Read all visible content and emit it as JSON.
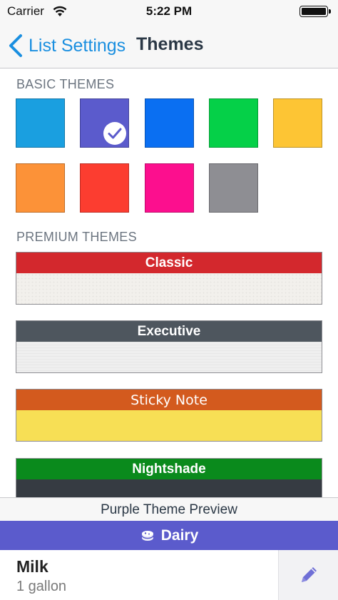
{
  "status_bar": {
    "carrier": "Carrier",
    "time": "5:22 PM"
  },
  "nav": {
    "back_label": "List Settings",
    "title": "Themes"
  },
  "basic_themes": {
    "header": "BASIC THEMES",
    "swatches": [
      {
        "color": "#1a9fe0",
        "selected": false
      },
      {
        "color": "#5b5bcc",
        "selected": true
      },
      {
        "color": "#0a6ff2",
        "selected": false
      },
      {
        "color": "#05d048",
        "selected": false
      },
      {
        "color": "#fdc534",
        "selected": false
      },
      {
        "color": "#fc9238",
        "selected": false
      },
      {
        "color": "#fc3d30",
        "selected": false
      },
      {
        "color": "#fc0f8e",
        "selected": false
      },
      {
        "color": "#8e8e93",
        "selected": false
      }
    ]
  },
  "premium_themes": {
    "header": "PREMIUM THEMES",
    "items": [
      {
        "name": "Classic",
        "banner_color": "#d3282d"
      },
      {
        "name": "Executive",
        "banner_color": "#4e565e"
      },
      {
        "name": "Sticky Note",
        "banner_color": "#d35a1e"
      },
      {
        "name": "Nightshade",
        "banner_color": "#0a8a1c"
      }
    ]
  },
  "preview": {
    "label": "Purple Theme Preview",
    "category": "Dairy",
    "category_icon": "cheese-icon",
    "item_name": "Milk",
    "item_quantity": "1 gallon",
    "edit_icon": "pencil-icon",
    "accent_color": "#5b5bcc"
  }
}
